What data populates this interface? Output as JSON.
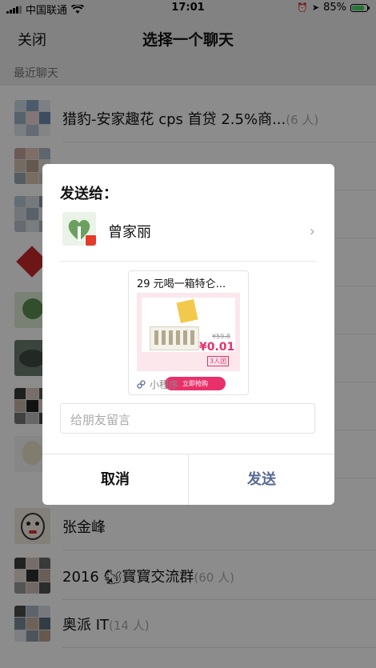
{
  "status_bar": {
    "carrier": "中国联通",
    "time": "17:01",
    "battery_percent": "85%",
    "battery_level": 0.85
  },
  "nav": {
    "close_label": "关闭",
    "title": "选择一个聊天"
  },
  "section_label": "最近聊天",
  "chats": [
    {
      "name": "猎豹-安家趣花 cps 首贷 2.5%商...",
      "count": "(6 人)"
    },
    {
      "name": "",
      "count": ""
    },
    {
      "name": "",
      "count": ""
    },
    {
      "name": "",
      "count": ""
    },
    {
      "name": "",
      "count": ""
    },
    {
      "name": "",
      "count": ""
    },
    {
      "name": "",
      "count": ""
    },
    {
      "name": "",
      "count": ""
    },
    {
      "name": "张金峰",
      "count": ""
    },
    {
      "name": "2016 🐿寳寳交流群",
      "count": "(60 人)"
    },
    {
      "name": "奥派 IT",
      "count": "(14 人)"
    }
  ],
  "dialog": {
    "header": "发送给：",
    "recipient_name": "曾家丽",
    "card": {
      "title": "29 元喝一箱特仑...",
      "old_price": "¥59.8",
      "price": "¥0.01",
      "team_label": "3人团",
      "buy_label": "立即抢购",
      "footer_label": "小程序"
    },
    "message_placeholder": "给朋友留言",
    "cancel_label": "取消",
    "send_label": "发送"
  },
  "colors": {
    "send_blue": "#576b95",
    "price_pink": "#e8316b"
  }
}
